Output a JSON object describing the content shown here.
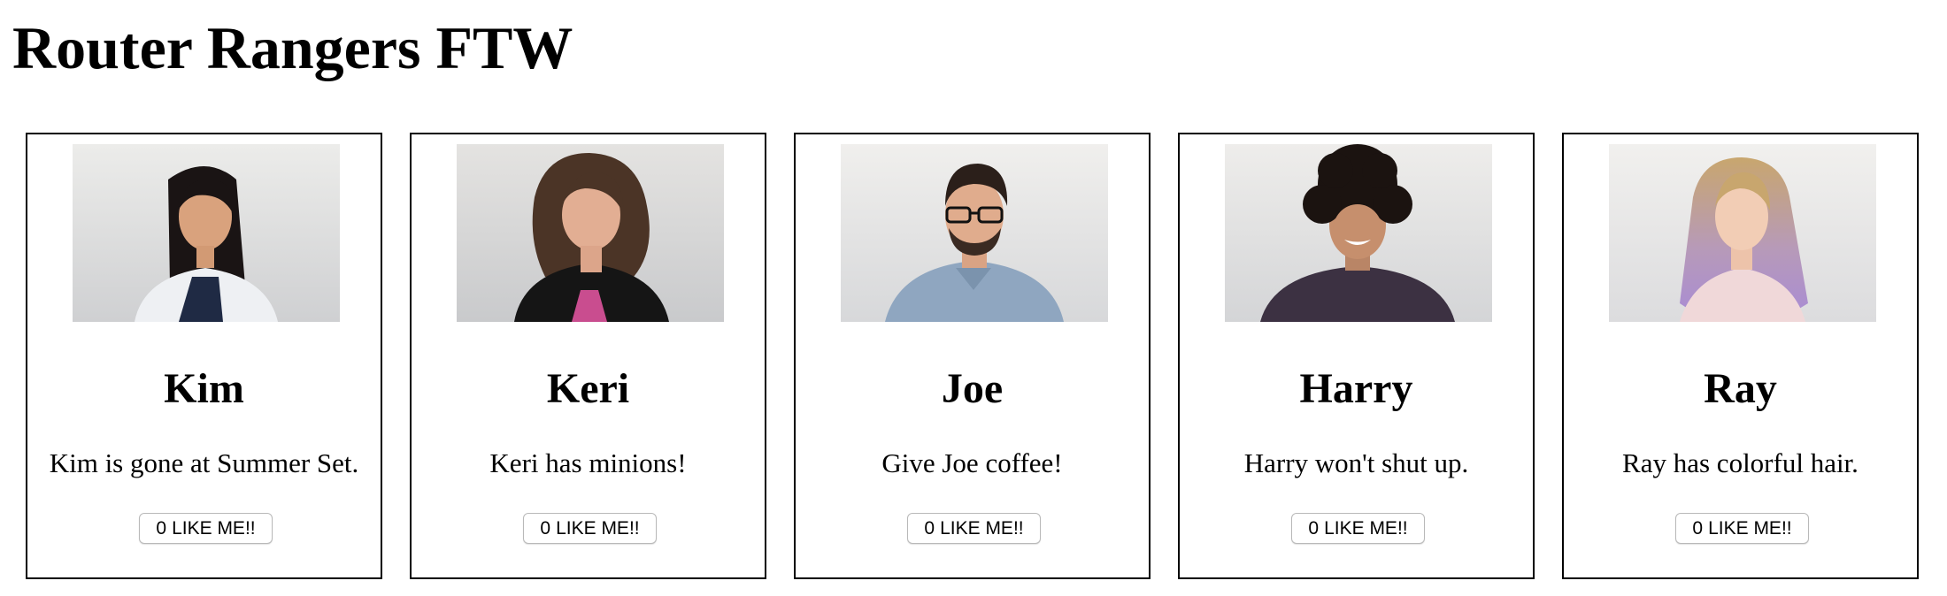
{
  "page": {
    "title": "Router Rangers FTW"
  },
  "button": {
    "label": "LIKE ME!!"
  },
  "cards": [
    {
      "name": "Kim",
      "description": "Kim is gone at Summer Set.",
      "likes": "0"
    },
    {
      "name": "Keri",
      "description": "Keri has minions!",
      "likes": "0"
    },
    {
      "name": "Joe",
      "description": "Give Joe coffee!",
      "likes": "0"
    },
    {
      "name": "Harry",
      "description": "Harry won't shut up.",
      "likes": "0"
    },
    {
      "name": "Ray",
      "description": "Ray has colorful hair.",
      "likes": "0"
    }
  ],
  "colors": {
    "photo_background": "#e6e6e6",
    "card_border": "#000000"
  }
}
